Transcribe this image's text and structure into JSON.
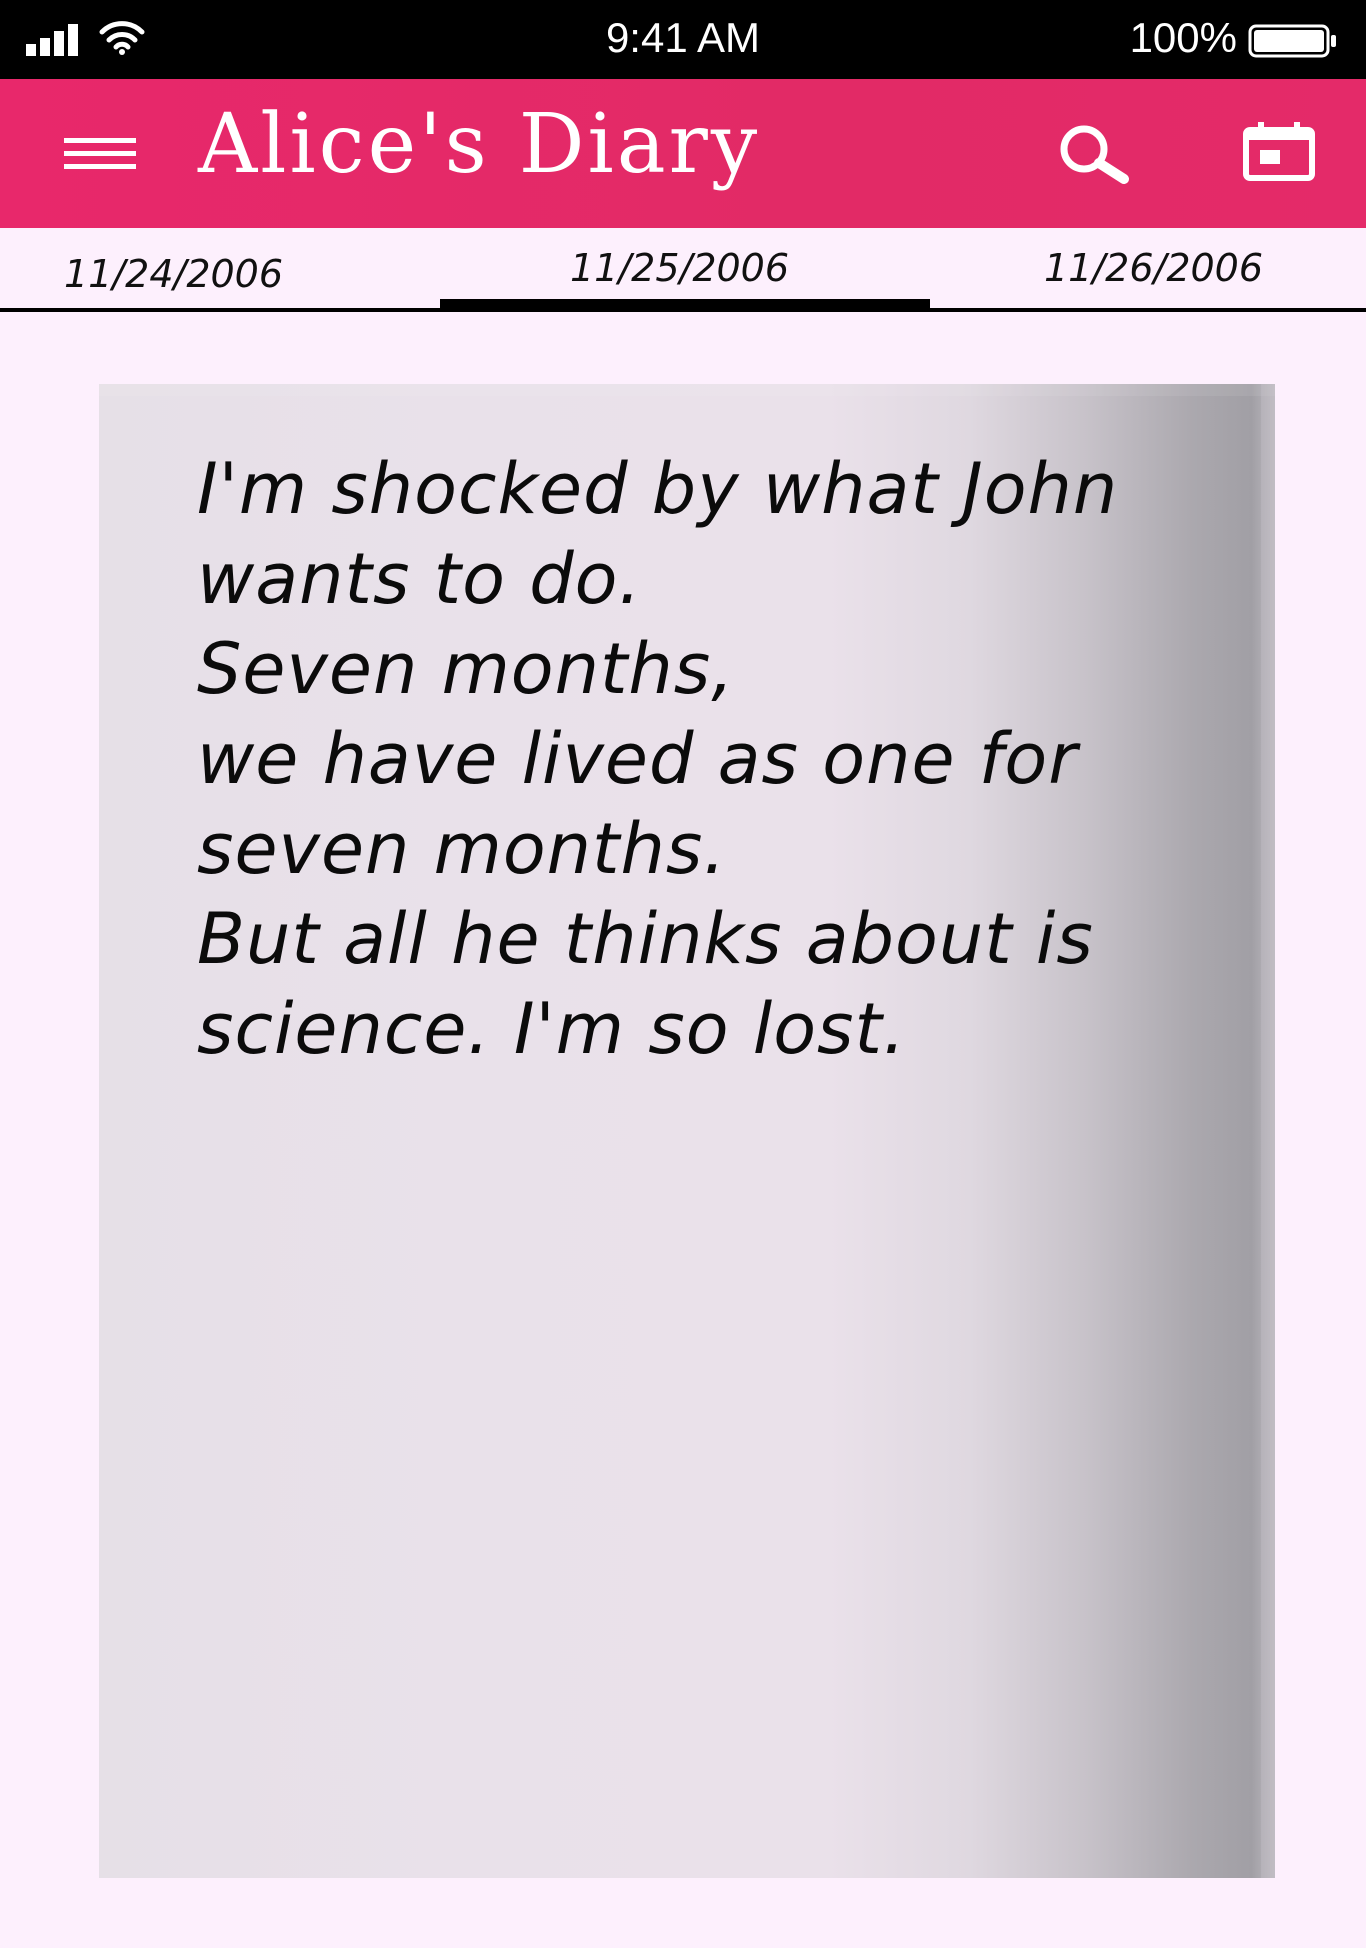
{
  "status_bar": {
    "time": "9:41 AM",
    "battery": "100%",
    "icons": [
      "signal-icon",
      "wifi-icon",
      "battery-icon"
    ]
  },
  "app_bar": {
    "title": "Alice's Diary",
    "icons": [
      "menu-icon",
      "search-icon",
      "calendar-icon"
    ],
    "color": "#e6296a"
  },
  "tabs": {
    "items": [
      "11/24/2006",
      "11/25/2006",
      "11/26/2006"
    ],
    "selected": "11/25/2006"
  },
  "entry": {
    "lines": [
      "I'm shocked by what John",
      "wants to do.",
      "Seven months,",
      "we have lived as one for",
      "seven months.",
      "But all he thinks about is",
      "science. I'm so lost."
    ]
  },
  "colors": {
    "background": "#fdf0fd",
    "page": "#e9e1ea",
    "accent": "#e6296a"
  }
}
